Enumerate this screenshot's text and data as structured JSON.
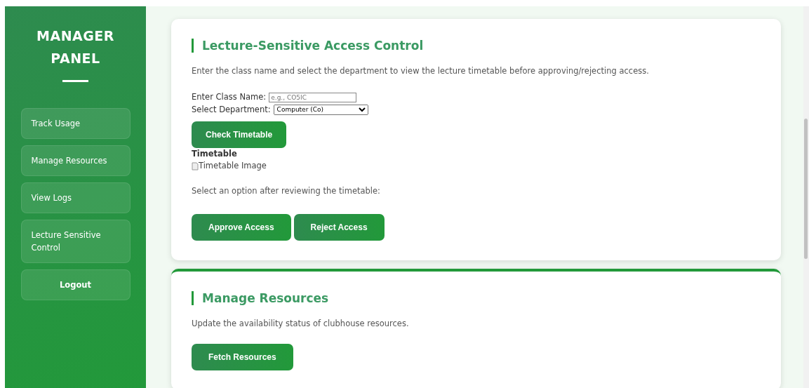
{
  "sidebar": {
    "title": "MANAGER PANEL",
    "items": [
      {
        "label": "Track Usage",
        "kind": "nav"
      },
      {
        "label": "Manage Resources",
        "kind": "nav"
      },
      {
        "label": "View Logs",
        "kind": "nav"
      },
      {
        "label": "Lecture Sensitive Control",
        "kind": "nav"
      },
      {
        "label": "Logout",
        "kind": "logout"
      }
    ]
  },
  "sections": [
    {
      "title": "Lecture-Sensitive Access Control",
      "top_accent": false,
      "description": "Enter the class name and select the department to view the lecture timetable before approving/rejecting access.",
      "class_field": {
        "label": "Enter Class Name:",
        "placeholder": "e.g., CO5IC"
      },
      "department_field": {
        "label": "Select Department:",
        "value": "Computer (Co)"
      },
      "check_button": "Check Timetable",
      "timetable_heading": "Timetable",
      "timetable_image_alt": "Timetable Image",
      "prompt": "Select an option after reviewing the timetable:",
      "buttons": [
        "Approve Access",
        "Reject Access"
      ]
    },
    {
      "title": "Manage Resources",
      "top_accent": true,
      "description": "Update the availability status of clubhouse resources.",
      "buttons": [
        "Fetch Resources"
      ]
    }
  ]
}
